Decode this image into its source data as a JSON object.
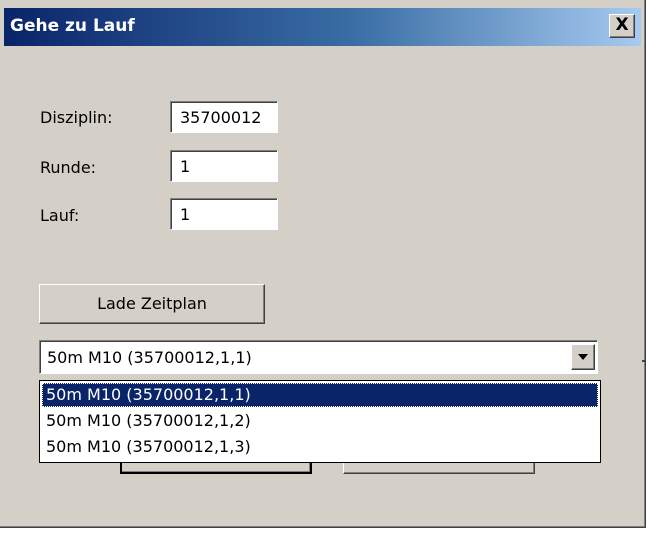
{
  "dialog": {
    "title": "Gehe zu Lauf",
    "close_label": "X"
  },
  "fields": {
    "disziplin": {
      "label": "Disziplin:",
      "value": "35700012"
    },
    "runde": {
      "label": "Runde:",
      "value": "1"
    },
    "lauf": {
      "label": "Lauf:",
      "value": "1"
    }
  },
  "buttons": {
    "load_schedule": "Lade Zeitplan"
  },
  "combo": {
    "selected": "50m M10 (35700012,1,1)",
    "options": [
      {
        "label": "50m M10 (35700012,1,1)",
        "selected": true
      },
      {
        "label": "50m M10 (35700012,1,2)",
        "selected": false
      },
      {
        "label": "50m M10 (35700012,1,3)",
        "selected": false
      }
    ]
  },
  "colors": {
    "titlebar_start": "#0a246a",
    "titlebar_end": "#a6caf0",
    "dialog_bg": "#d4d0c8",
    "selection_bg": "#0a246a"
  }
}
